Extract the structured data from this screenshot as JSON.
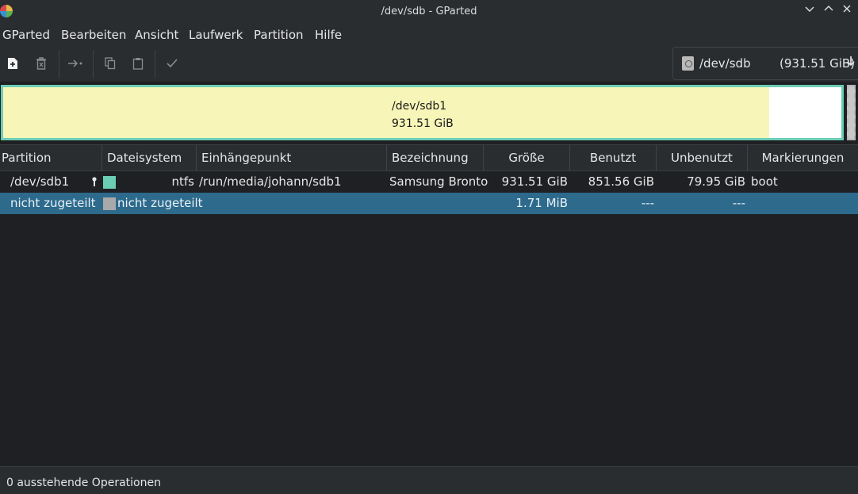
{
  "window": {
    "title": "/dev/sdb - GParted",
    "controls": [
      "chevron-down",
      "chevron-up",
      "close"
    ]
  },
  "menu": {
    "items": [
      "GParted",
      "Bearbeiten",
      "Ansicht",
      "Laufwerk",
      "Partition",
      "Hilfe"
    ]
  },
  "toolbar": {
    "buttons": [
      "new-partition",
      "delete-partition",
      "resize-move",
      "copy",
      "paste",
      "apply"
    ],
    "device": {
      "name": "/dev/sdb",
      "size": "(931.51 GiB)"
    }
  },
  "diskmap": {
    "partition_name": "/dev/sdb1",
    "partition_size": "931.51 GiB",
    "fs_color": "#6ccdb5",
    "used_color": "#f7f6b8",
    "unallocated_color": "#c8c8c8"
  },
  "table": {
    "headers": [
      "Partition",
      "Dateisystem",
      "Einhängepunkt",
      "Bezeichnung",
      "Größe",
      "Benutzt",
      "Unbenutzt",
      "Markierungen"
    ],
    "rows": [
      {
        "partition": "/dev/sdb1",
        "filesystem": "ntfs",
        "fs_color": "#6ccdb5",
        "mountpoint": "/run/media/johann/sdb1",
        "label": "Samsung Bronto",
        "size": "931.51 GiB",
        "used": "851.56 GiB",
        "unused": "79.95 GiB",
        "flags": "boot"
      },
      {
        "partition": "nicht zugeteilt",
        "filesystem": "nicht zugeteilt",
        "fs_color": "#a9a9a9",
        "mountpoint": "",
        "label": "",
        "size": "1.71 MiB",
        "used": "---",
        "unused": "---",
        "flags": ""
      }
    ]
  },
  "status": {
    "text": "0 ausstehende Operationen"
  },
  "colors": {
    "selection": "#2d6a8c",
    "background": "#1e2023",
    "chrome": "#2a2d30"
  }
}
